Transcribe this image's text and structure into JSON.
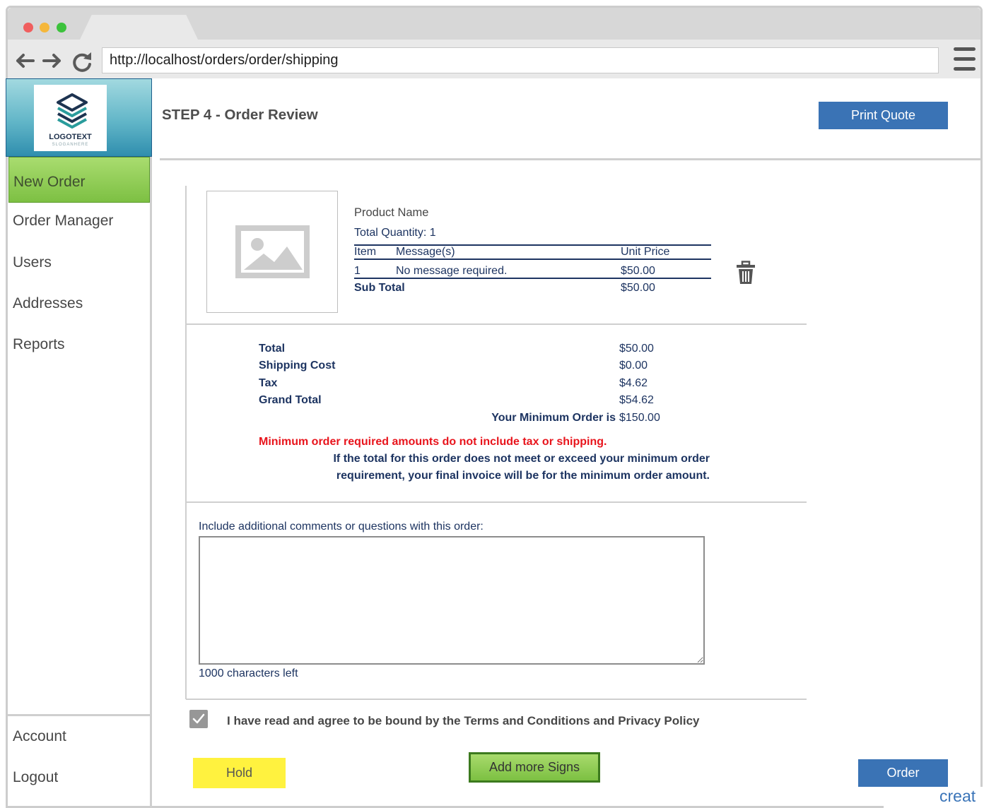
{
  "browser": {
    "url": "http://localhost/orders/order/shipping"
  },
  "logo": {
    "name": "LOGOTEXT",
    "slogan": "SLOGANHERE"
  },
  "sidebar": {
    "items": [
      {
        "label": "New Order",
        "active": true
      },
      {
        "label": "Order Manager",
        "active": false
      },
      {
        "label": "Users",
        "active": false
      },
      {
        "label": "Addresses",
        "active": false
      },
      {
        "label": "Reports",
        "active": false
      }
    ],
    "bottom_items": [
      {
        "label": "Account"
      },
      {
        "label": "Logout"
      }
    ]
  },
  "header": {
    "title": "STEP 4 - Order Review",
    "print_quote_label": "Print Quote"
  },
  "product": {
    "name": "Product Name",
    "total_quantity": "Total Quantity: 1",
    "table": {
      "headers": [
        "Item",
        "Message(s)",
        "Unit Price"
      ],
      "rows": [
        [
          "1",
          "No message required.",
          "$50.00"
        ]
      ]
    },
    "subtotal": {
      "label": "Sub Total",
      "value": "$50.00"
    }
  },
  "totals": {
    "rows": [
      {
        "label": "Total",
        "value": "$50.00"
      },
      {
        "label": "Shipping Cost",
        "value": "$0.00"
      },
      {
        "label": "Tax",
        "value": "$4.62"
      },
      {
        "label": "Grand Total",
        "value": "$54.62"
      }
    ],
    "minimum": {
      "label": "Your Minimum Order is",
      "value": "$150.00"
    },
    "warning": "Minimum order required amounts do not include tax or shipping.",
    "notice": [
      "If the total for this order does not meet or exceed your minimum order",
      "requirement, your final invoice will be for the minimum order amount."
    ]
  },
  "comments": {
    "label": "Include additional comments or questions with this order:",
    "chars_left": "1000 characters left"
  },
  "terms": {
    "checked": true,
    "label": "I have read and agree to be bound by the Terms and Conditions and Privacy Policy"
  },
  "actions": {
    "hold": "Hold",
    "add_more": "Add more Signs",
    "order": "Order"
  },
  "watermark": "creat",
  "icons": [
    "back-arrow-icon",
    "forward-arrow-icon",
    "refresh-icon",
    "hamburger-menu-icon",
    "logo-icon",
    "image-placeholder-icon",
    "trash-icon",
    "checkmark-icon"
  ],
  "colors": {
    "primary_button": "#3a73b5",
    "active_nav": "#8cc94f",
    "hold_button": "#fff23f",
    "text_navy": "#1d3461",
    "warning_red": "#e8141c"
  }
}
